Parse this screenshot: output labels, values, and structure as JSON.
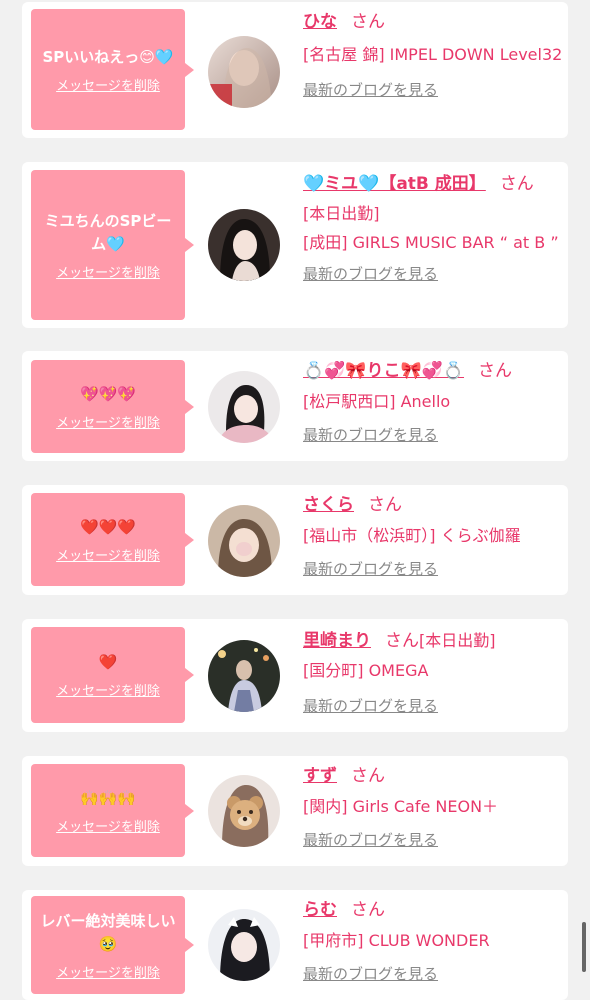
{
  "colors": {
    "page_bg": "#f1f1f1",
    "card_bg": "#ffffff",
    "bubble_bg": "#ff9aaa",
    "accent_pink": "#e8386a",
    "link_grey": "#888888"
  },
  "entries": [
    {
      "message": "SPいいねえっ😊🩵",
      "delete_label": "メッセージを削除",
      "name": "ひな",
      "honorific": "さん",
      "inline_status": "",
      "shop_lines": [
        "[名古屋 錦] IMPEL DOWN Level32"
      ],
      "blog_label": "最新のブログを見る"
    },
    {
      "message": "ミユちんのSPビーム🩵",
      "delete_label": "メッセージを削除",
      "name": "🩵ミユ🩵【atB 成田】",
      "honorific": "さん",
      "inline_status": "",
      "shop_lines": [
        "[本日出勤]",
        "[成田] GIRLS MUSIC BAR “ at B ”"
      ],
      "blog_label": "最新のブログを見る"
    },
    {
      "message": "💖💖💖",
      "delete_label": "メッセージを削除",
      "name": "💍💞🎀りこ🎀💞💍",
      "honorific": "さん",
      "inline_status": "",
      "shop_lines": [
        "[松戸駅西口] Anello"
      ],
      "blog_label": "最新のブログを見る"
    },
    {
      "message": "❤️❤️❤️",
      "delete_label": "メッセージを削除",
      "name": "さくら",
      "honorific": "さん",
      "inline_status": "",
      "shop_lines": [
        "[福山市（松浜町）] くらぶ伽羅"
      ],
      "blog_label": "最新のブログを見る"
    },
    {
      "message": "❤️",
      "delete_label": "メッセージを削除",
      "name": "里崎まり",
      "honorific": "さん",
      "inline_status": "[本日出勤]",
      "shop_lines": [
        "[国分町] OMEGA"
      ],
      "blog_label": "最新のブログを見る"
    },
    {
      "message": "🙌🙌🙌",
      "delete_label": "メッセージを削除",
      "name": "すず",
      "honorific": "さん",
      "inline_status": "",
      "shop_lines": [
        "[関内] Girls Cafe NEON＋"
      ],
      "blog_label": "最新のブログを見る"
    },
    {
      "message": "レバー絶対美味しい🥹",
      "delete_label": "メッセージを削除",
      "name": "らむ",
      "honorific": "さん",
      "inline_status": "",
      "shop_lines": [
        "[甲府市] CLUB WONDER"
      ],
      "blog_label": "最新のブログを見る"
    }
  ]
}
